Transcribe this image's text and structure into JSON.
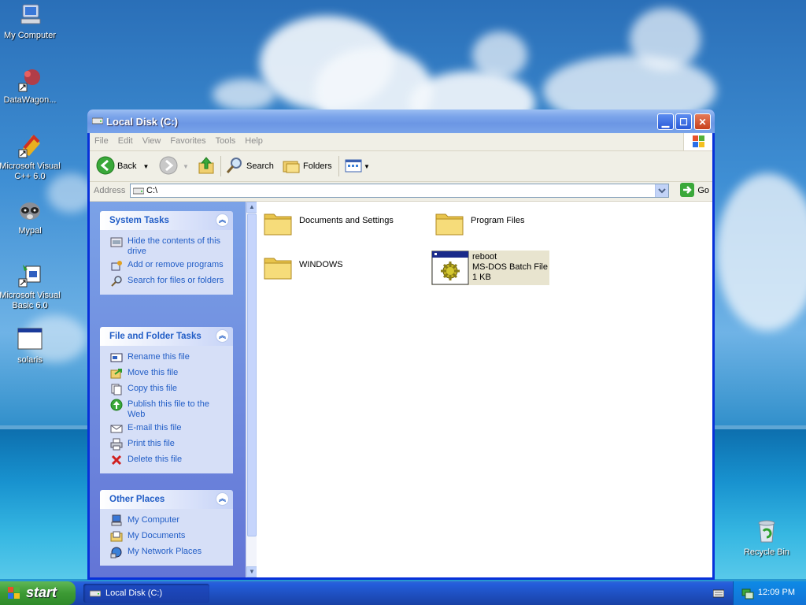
{
  "desktop": {
    "icons": [
      {
        "label": "My Computer"
      },
      {
        "label": "DataWagon..."
      },
      {
        "label": "Microsoft Visual C++ 6.0"
      },
      {
        "label": "Mypal"
      },
      {
        "label": "Microsoft Visual Basic 6.0"
      },
      {
        "label": "solaris"
      },
      {
        "label": "Recycle Bin"
      }
    ]
  },
  "window": {
    "title": "Local Disk (C:)",
    "menu": [
      "File",
      "Edit",
      "View",
      "Favorites",
      "Tools",
      "Help"
    ],
    "toolbar": {
      "back_label": "Back",
      "search_label": "Search",
      "folders_label": "Folders"
    },
    "address": {
      "label": "Address",
      "value": "C:\\",
      "go_label": "Go"
    },
    "left_pane": {
      "system_tasks": {
        "title": "System Tasks",
        "items": [
          "Hide the contents of this drive",
          "Add or remove programs",
          "Search for files or folders"
        ]
      },
      "file_tasks": {
        "title": "File and Folder Tasks",
        "items": [
          "Rename this file",
          "Move this file",
          "Copy this file",
          "Publish this file to the Web",
          "E-mail this file",
          "Print this file",
          "Delete this file"
        ]
      },
      "other_places": {
        "title": "Other Places",
        "items": [
          "My Computer",
          "My Documents",
          "My Network Places"
        ]
      }
    },
    "content": {
      "items": [
        {
          "name": "Documents and Settings",
          "type": "folder"
        },
        {
          "name": "Program Files",
          "type": "folder"
        },
        {
          "name": "WINDOWS",
          "type": "folder"
        },
        {
          "name": "reboot",
          "type": "batch",
          "kind": "MS-DOS Batch File",
          "size": "1 KB"
        }
      ]
    }
  },
  "taskbar": {
    "start_label": "start",
    "task_label": "Local Disk (C:)",
    "clock": "12:09 PM"
  }
}
